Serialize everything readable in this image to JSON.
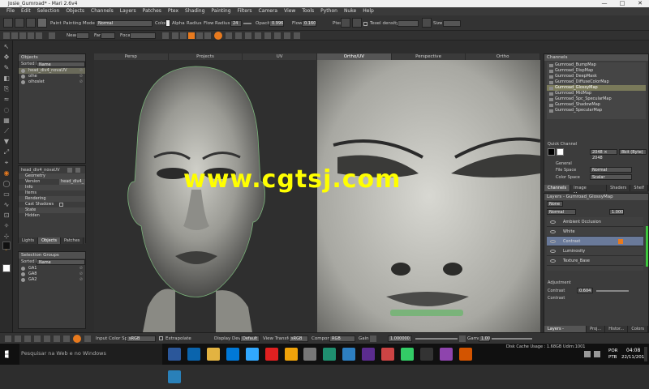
{
  "window": {
    "title": "Josie_Gumroad* - Mari 2.6v4",
    "controls": [
      "—",
      "□",
      "✕"
    ]
  },
  "menu": [
    "File",
    "Edit",
    "Selection",
    "Objects",
    "Channels",
    "Layers",
    "Patches",
    "Ptex",
    "Shading",
    "Painting",
    "Filters",
    "Camera",
    "View",
    "Tools",
    "Python",
    "Nuke",
    "Help"
  ],
  "toolbar1": {
    "paint_label": "Paint",
    "painting_mode_label": "Painting Mode",
    "painting_mode_value": "Normal",
    "colors_label": "Colors",
    "alpha_label": "Alpha",
    "radius_label": "Radius",
    "flow_label": "Flow",
    "radius2_label": "Radius",
    "radius_value": "24",
    "opacity_label": "Opacity",
    "opacity_value": "0.996",
    "flow2_label": "Flow",
    "flow_value": "0.160",
    "ptex_label": "Ptex",
    "texel_density_label": "Texel density",
    "size_label": "Size"
  },
  "toolbar2": {
    "near_label": "Near",
    "far_label": "Far",
    "focal_label": "Focal"
  },
  "objects_panel": {
    "title": "Objects",
    "sorted_by_label": "Sorted by",
    "sorted_by_value": "Name",
    "items": [
      {
        "name": "head_div4_novaUV",
        "selected": true
      },
      {
        "name": "olhe",
        "selected": false
      },
      {
        "name": "olhoslet",
        "selected": false
      }
    ]
  },
  "properties_panel": {
    "object_name": "head_div4_novaUV",
    "sections": [
      {
        "label": "Geometry"
      },
      {
        "label": "Version",
        "value": "head_div4_"
      },
      {
        "label": "Info"
      },
      {
        "label": "Items"
      },
      {
        "label": "Rendering"
      },
      {
        "label": "Cast Shadows"
      },
      {
        "label": "State"
      },
      {
        "label": "Hidden"
      }
    ],
    "tabs": [
      "Lights",
      "Objects",
      "Patches"
    ]
  },
  "selection_groups": {
    "title": "Selection Groups",
    "sorted_by_label": "Sorted by",
    "sorted_by_value": "Name",
    "items": [
      "GA1",
      "GA8",
      "GA2"
    ]
  },
  "view_tabs": [
    {
      "label": "Persp",
      "active": false
    },
    {
      "label": "Projects",
      "active": false
    },
    {
      "label": "UV",
      "active": false
    },
    {
      "label": "Ortho/UV",
      "active": true
    },
    {
      "label": "Perspective",
      "active": false
    },
    {
      "label": "Ortho",
      "active": false
    }
  ],
  "watermark": "www.cgtsj.com",
  "channels_panel": {
    "title": "Channels",
    "items": [
      {
        "name": "Gumroad_BumpMap",
        "selected": false
      },
      {
        "name": "Gumroad_DispMap",
        "selected": false
      },
      {
        "name": "Gumroad_DeepMask",
        "selected": false
      },
      {
        "name": "Gumroad_DiffuseColorMap",
        "selected": false
      },
      {
        "name": "Gumroad_GlossyMap",
        "selected": true
      },
      {
        "name": "Gumroad_MidMap",
        "selected": false
      },
      {
        "name": "Gumroad_Spc_SpecularMap",
        "selected": false
      },
      {
        "name": "Gumroad_ShadowMap",
        "selected": false
      },
      {
        "name": "Gumroad_SpecularMap",
        "selected": false
      }
    ],
    "quick_channel_label": "Quick Channel",
    "quick_channel_size": "2048 × 2048",
    "quick_channel_depth": "8bit (Byte)",
    "general_label": "General",
    "file_space_label": "File Space",
    "file_space_value": "Normal",
    "color_space_label": "Color Space",
    "color_space_value": "Scalar",
    "bottom_tabs": [
      "Channels",
      "Image Manager",
      "Shaders",
      "Shelf"
    ]
  },
  "layers_panel": {
    "title": "Layers - Gumroad_GlossyMap",
    "blend_value": "Normal",
    "opacity_value": "1.000",
    "filter_value": "None",
    "layers": [
      {
        "name": "Ambient Occlusion",
        "selected": false
      },
      {
        "name": "White",
        "selected": false
      },
      {
        "name": "Contrast",
        "selected": true
      },
      {
        "name": "Luminosity",
        "selected": false
      },
      {
        "name": "Texture_Base",
        "selected": false
      }
    ],
    "adjustment_label": "Adjustment",
    "contrast_label": "Contrast",
    "contrast_value": "0.604",
    "contrast2_label": "Contrast",
    "bottom_tabs": [
      "Layers - Gumroad_Glos...",
      "Proj...",
      "Histor...",
      "Colors"
    ]
  },
  "bottombar": {
    "input_color_space_label": "Input Color Space",
    "input_color_space_value": "sRGB",
    "extrapolate_label": "Extrapolate",
    "display_device_label": "Display Device",
    "display_device_value": "Default",
    "view_transform_label": "View Transform",
    "view_transform_value": "sRGB",
    "component_label": "Component",
    "component_value": "RGB",
    "gain_label": "Gain",
    "gain_value": "1.000000",
    "gamma_label": "Gamma",
    "gamma_value": "1.00",
    "disk_cache_usage": "Disk Cache Usage : 1.68GB Udim:1001"
  },
  "taskbar": {
    "search_placeholder": "Pesquisar na Web e no Windows",
    "language_top": "POR",
    "language_bottom": "PTB",
    "time": "04:08",
    "date": "22/11/2015"
  },
  "colors": {
    "accent_orange": "#e87a1e",
    "selection_yellow": "#7a7a5a",
    "watermark": "#ffff00",
    "layer_green": "#3cc53c"
  }
}
